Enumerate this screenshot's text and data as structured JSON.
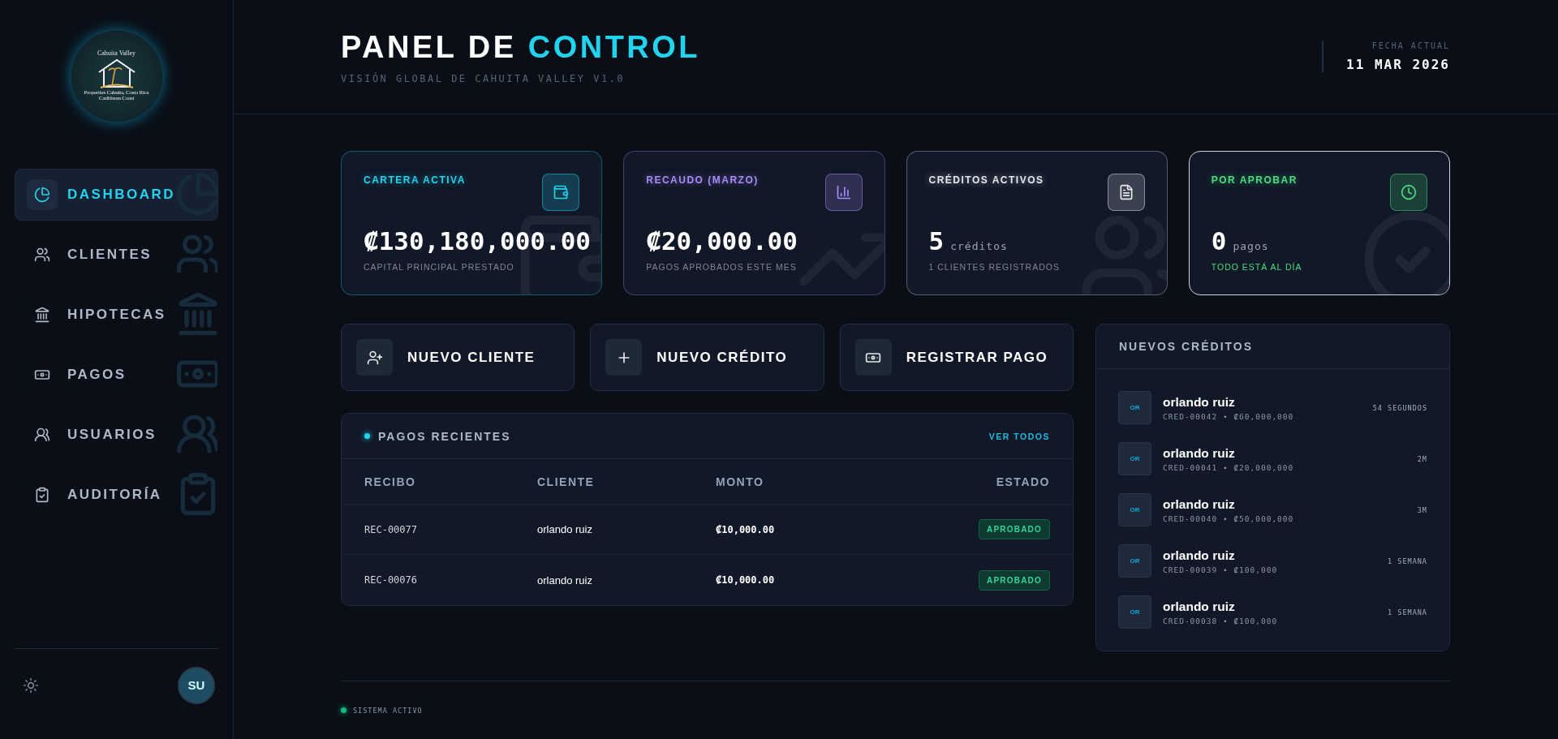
{
  "sidebar": {
    "logo": {
      "title": "Cahuita Valley",
      "line_1": "Properties Cahuita, Costa Rica",
      "line_2": "Caribbean Coast"
    },
    "items": [
      {
        "label": "DASHBOARD",
        "selected": true
      },
      {
        "label": "CLIENTES",
        "selected": false
      },
      {
        "label": "HIPOTECAS",
        "selected": false
      },
      {
        "label": "PAGOS",
        "selected": false
      },
      {
        "label": "USUARIOS",
        "selected": false
      },
      {
        "label": "AUDITORÍA",
        "selected": false
      }
    ],
    "avatar": "SU"
  },
  "header": {
    "title": "PANEL DE",
    "title_accent": "CONTROL",
    "subtitle": "VISIÓN GLOBAL DE CAHUITA VALLEY V1.0",
    "date_label": "FECHA ACTUAL",
    "date": "11 MAR 2026"
  },
  "stats": [
    {
      "label": "CARTERA ACTIVA",
      "value": "₡130,180,000.00",
      "note": "CAPITAL PRINCIPAL PRESTADO",
      "color": "#22d3ee"
    },
    {
      "label": "RECAUDO (MARZO)",
      "value": "₡20,000.00",
      "note": "PAGOS APROBADOS ESTE MES",
      "color": "#a78bfa"
    },
    {
      "label": "CRÉDITOS ACTIVOS",
      "value": "5",
      "unit": "créditos",
      "note": "1 CLIENTES REGISTRADOS",
      "color": "#e5e7eb"
    },
    {
      "label": "POR APROBAR",
      "value": "0",
      "unit": "pagos",
      "note": "TODO ESTÁ AL DÍA",
      "color": "#4ade80"
    }
  ],
  "actions": [
    "NUEVO CLIENTE",
    "NUEVO CRÉDITO",
    "REGISTRAR PAGO"
  ],
  "recent_payments": {
    "title": "PAGOS RECIENTES",
    "link": "VER TODOS",
    "columns": [
      "RECIBO",
      "CLIENTE",
      "MONTO",
      "ESTADO"
    ],
    "rows": [
      {
        "receipt": "REC-00077",
        "client": "orlando ruiz",
        "amount": "₡10,000.00",
        "status": "APROBADO"
      },
      {
        "receipt": "REC-00076",
        "client": "orlando ruiz",
        "amount": "₡10,000.00",
        "status": "APROBADO"
      }
    ]
  },
  "new_credits": {
    "title": "NUEVOS CRÉDITOS",
    "items": [
      {
        "initials": "OR",
        "name": "orlando ruiz",
        "detail": "CRED-00042 • ₡60,000,000",
        "time": "54 SEGUNDOS"
      },
      {
        "initials": "OR",
        "name": "orlando ruiz",
        "detail": "CRED-00041 • ₡20,000,000",
        "time": "2M"
      },
      {
        "initials": "OR",
        "name": "orlando ruiz",
        "detail": "CRED-00040 • ₡50,000,000",
        "time": "3M"
      },
      {
        "initials": "OR",
        "name": "orlando ruiz",
        "detail": "CRED-00039 • ₡100,000",
        "time": "1 SEMANA"
      },
      {
        "initials": "OR",
        "name": "orlando ruiz",
        "detail": "CRED-00038 • ₡100,000",
        "time": "1 SEMANA"
      }
    ]
  },
  "footer": {
    "status": "SISTEMA ACTIVO"
  }
}
